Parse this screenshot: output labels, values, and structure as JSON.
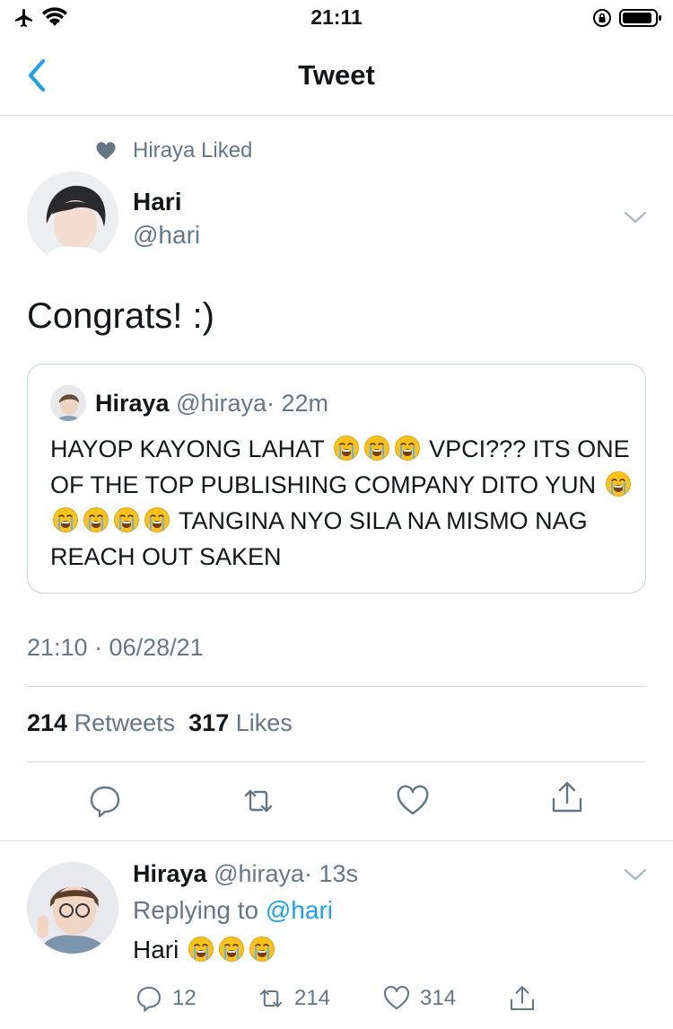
{
  "status_bar": {
    "time": "21:11"
  },
  "nav": {
    "title": "Tweet"
  },
  "social_context": {
    "text": "Hiraya Liked"
  },
  "tweet": {
    "author_name": "Hari",
    "author_handle": "@hari",
    "text": "Congrats! :)",
    "timestamp": "21:10 · 06/28/21",
    "retweet_count": "214",
    "retweet_label": "Retweets",
    "like_count": "317",
    "like_label": "Likes"
  },
  "quoted_tweet": {
    "author_name": "Hiraya",
    "author_handle": "@hiraya",
    "time": "· 22m",
    "segments": {
      "a": "HAYOP KAYONG LAHAT ",
      "b": " VPCI??? ITS ONE OF THE TOP PUBLISHING COMPANY DITO YUN ",
      "c": " TANGINA NYO SILA NA MISMO NAG REACH OUT SAKEN"
    }
  },
  "reply": {
    "author_name": "Hiraya",
    "author_handle": "@hiraya",
    "time": "· 13s",
    "replying_prefix": "Replying to ",
    "replying_to": "@hari",
    "text": "Hari ",
    "reply_count": "12",
    "retweet_count": "214",
    "like_count": "314"
  },
  "icons": {
    "back": "chevron-left-icon",
    "heart": "heart-icon",
    "reply": "comment-icon",
    "retweet": "retweet-icon",
    "share": "share-icon",
    "emoji": "loudly-crying-face-emoji"
  },
  "colors": {
    "accent": "#1da1f2",
    "secondary_text": "#657786",
    "border": "#ccd6dd"
  }
}
